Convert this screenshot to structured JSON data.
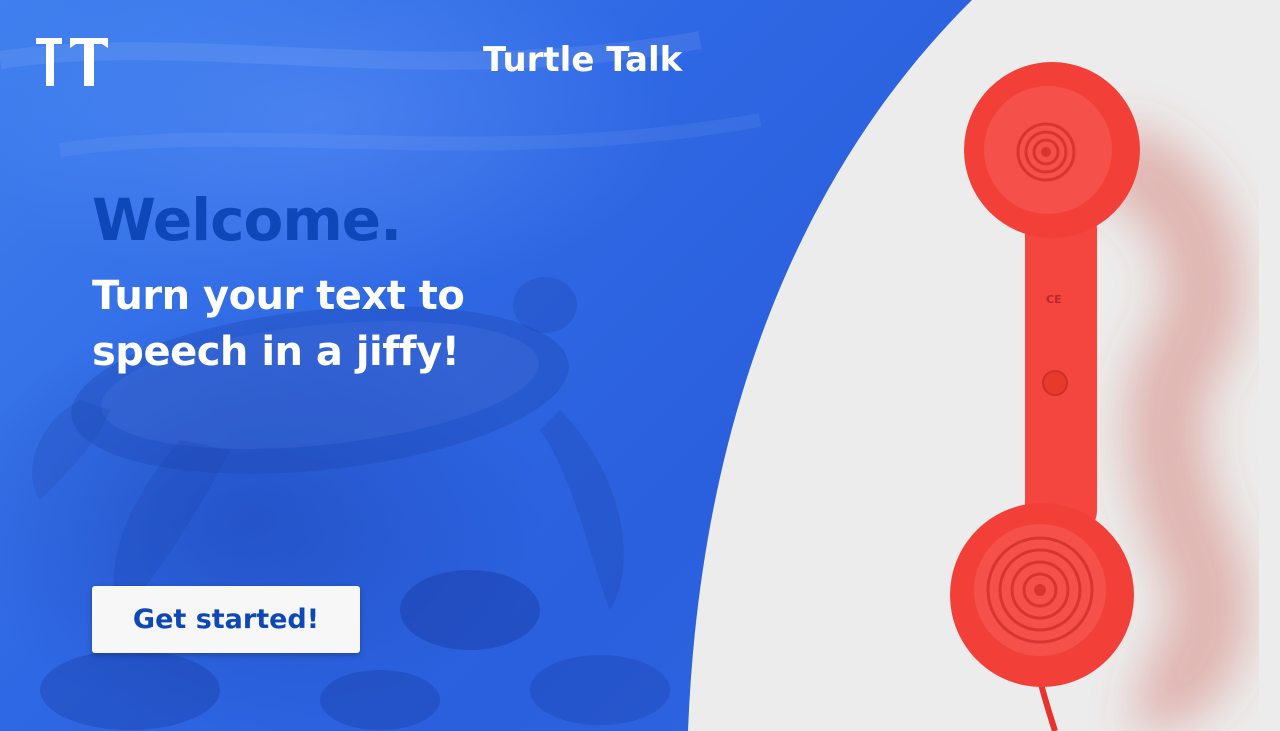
{
  "header": {
    "logo_icon": "tt-monogram-icon",
    "title": "Turtle Talk"
  },
  "hero": {
    "heading": "Welcome.",
    "subheading": "Turn your text to speech in a jiffy!",
    "cta_label": "Get started!"
  },
  "illustration": {
    "background_image": "sea-turtle-underwater-photo",
    "side_image": "red-telephone-handset-photo",
    "phone_label": "CE"
  },
  "colors": {
    "hero_blue": "#2f68e4",
    "heading_blue": "#0d47b8",
    "panel_white": "#ececec",
    "phone_red": "#f4453e"
  }
}
